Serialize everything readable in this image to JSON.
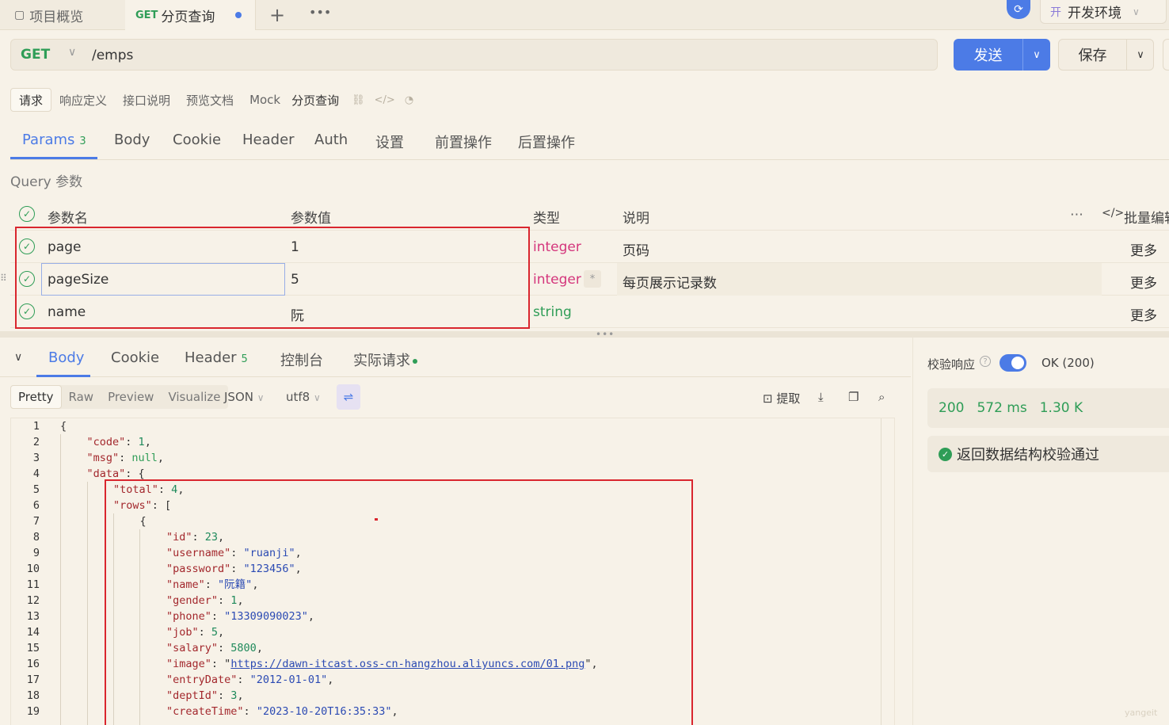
{
  "tabbar": {
    "overview_tab": "项目概览",
    "active_tab_method": "GET",
    "active_tab_title": "分页查询",
    "add_icon": "plus-icon",
    "more_icon": "more-dots-icon",
    "env_prefix": "开",
    "env_label": "开发环境"
  },
  "request": {
    "method": "GET",
    "path": "/emps",
    "send_label": "发送",
    "save_label": "保存"
  },
  "subtabs": [
    "请求",
    "响应定义",
    "接口说明",
    "预览文档",
    "Mock"
  ],
  "api_name": "分页查询",
  "param_tabs": {
    "params": "Params",
    "params_count": "3",
    "body": "Body",
    "cookie": "Cookie",
    "header": "Header",
    "auth": "Auth",
    "settings": "设置",
    "pre": "前置操作",
    "post": "后置操作"
  },
  "query_label": "Query 参数",
  "param_table": {
    "headers": {
      "name": "参数名",
      "value": "参数值",
      "type": "类型",
      "desc": "说明",
      "bulk": "批量编辑"
    },
    "rows": [
      {
        "name": "page",
        "value": "1",
        "type": "integer",
        "desc": "页码",
        "more": "更多"
      },
      {
        "name": "pageSize",
        "value": "5",
        "type": "integer",
        "desc": "每页展示记录数",
        "more": "更多",
        "required": "*"
      },
      {
        "name": "name",
        "value": "阮",
        "type": "string",
        "desc": "",
        "more": "更多"
      }
    ]
  },
  "response_tabs": {
    "body": "Body",
    "cookie": "Cookie",
    "header": "Header",
    "header_count": "5",
    "console": "控制台",
    "actual": "实际请求"
  },
  "format": {
    "modes": [
      "Pretty",
      "Raw",
      "Preview",
      "Visualize"
    ],
    "lang": "JSON",
    "encoding": "utf8",
    "extract": "提取"
  },
  "code_lines": [
    {
      "n": "1",
      "t": "{"
    },
    {
      "n": "2",
      "k": "\"code\"",
      "v": "1",
      "vt": "num",
      "tail": ","
    },
    {
      "n": "3",
      "k": "\"msg\"",
      "v": "null",
      "vt": "kw",
      "tail": ","
    },
    {
      "n": "4",
      "k": "\"data\"",
      "v": "{",
      "vt": "plain",
      "tail": ""
    },
    {
      "n": "5",
      "k": "\"total\"",
      "v": "4",
      "vt": "num",
      "tail": ","
    },
    {
      "n": "6",
      "k": "\"rows\"",
      "v": "[",
      "vt": "plain",
      "tail": ""
    },
    {
      "n": "7",
      "t": "{"
    },
    {
      "n": "8",
      "k": "\"id\"",
      "v": "23",
      "vt": "num",
      "tail": ","
    },
    {
      "n": "9",
      "k": "\"username\"",
      "v": "\"ruanji\"",
      "vt": "str",
      "tail": ","
    },
    {
      "n": "10",
      "k": "\"password\"",
      "v": "\"123456\"",
      "vt": "str",
      "tail": ","
    },
    {
      "n": "11",
      "k": "\"name\"",
      "v": "\"阮籍\"",
      "vt": "str",
      "tail": ","
    },
    {
      "n": "12",
      "k": "\"gender\"",
      "v": "1",
      "vt": "num",
      "tail": ","
    },
    {
      "n": "13",
      "k": "\"phone\"",
      "v": "\"13309090023\"",
      "vt": "str",
      "tail": ","
    },
    {
      "n": "14",
      "k": "\"job\"",
      "v": "5",
      "vt": "num",
      "tail": ","
    },
    {
      "n": "15",
      "k": "\"salary\"",
      "v": "5800",
      "vt": "num",
      "tail": ","
    },
    {
      "n": "16",
      "k": "\"image\"",
      "v": "https://dawn-itcast.oss-cn-hangzhou.aliyuncs.com/01.png",
      "vt": "link",
      "tail": ","
    },
    {
      "n": "17",
      "k": "\"entryDate\"",
      "v": "\"2012-01-01\"",
      "vt": "str",
      "tail": ","
    },
    {
      "n": "18",
      "k": "\"deptId\"",
      "v": "3",
      "vt": "num",
      "tail": ","
    },
    {
      "n": "19",
      "k": "\"createTime\"",
      "v": "\"2023-10-20T16:35:33\"",
      "vt": "str",
      "tail": ","
    }
  ],
  "validation": {
    "label": "校验响应",
    "status": "OK (200)",
    "code": "200",
    "time": "572 ms",
    "size": "1.30 K",
    "result": "返回数据结构校验通过"
  },
  "watermark": "yangeit"
}
